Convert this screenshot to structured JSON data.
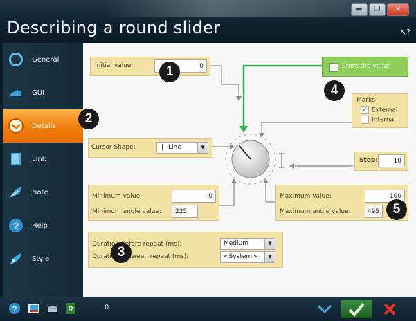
{
  "window": {
    "title": "Describing a round slider"
  },
  "sidebar": {
    "items": [
      {
        "label": "General",
        "icon": "ring-icon"
      },
      {
        "label": "GUI",
        "icon": "cloud-icon"
      },
      {
        "label": "Details",
        "icon": "details-icon",
        "active": true
      },
      {
        "label": "Link",
        "icon": "link-icon"
      },
      {
        "label": "Note",
        "icon": "note-icon"
      },
      {
        "label": "Help",
        "icon": "help-icon"
      },
      {
        "label": "Style",
        "icon": "style-icon"
      }
    ]
  },
  "form": {
    "initial_value_label": "Initial value:",
    "initial_value": "0",
    "store_value_label": "Store the value",
    "marks_title": "Marks",
    "marks_external": "External",
    "marks_internal": "Internal",
    "marks_external_checked": true,
    "cursor_shape_label": "Cursor Shape:",
    "cursor_shape_value": "Line",
    "step_label": "Step:",
    "step_value": "10",
    "minimum_value_label": "Minimum value:",
    "minimum_value": "0",
    "minimum_angle_label": "Minimum angle value:",
    "minimum_angle": "225",
    "maximum_value_label": "Maximum value:",
    "maximum_value": "100",
    "maximum_angle_label": "Maximum angle value:",
    "maximum_angle": "495",
    "duration_before_label": "Duration before repeat (ms):",
    "duration_before_value": "Medium",
    "duration_between_label": "Duration between repeat (ms):",
    "duration_between_value": "<System>"
  },
  "badges": [
    "1",
    "2",
    "3",
    "4",
    "5"
  ],
  "taskbar": {
    "count": "0"
  },
  "colors": {
    "accent": "#f07e0b",
    "panel": "#f2e2a6",
    "store": "#8ece5a",
    "arrow": "#2bb34a"
  }
}
